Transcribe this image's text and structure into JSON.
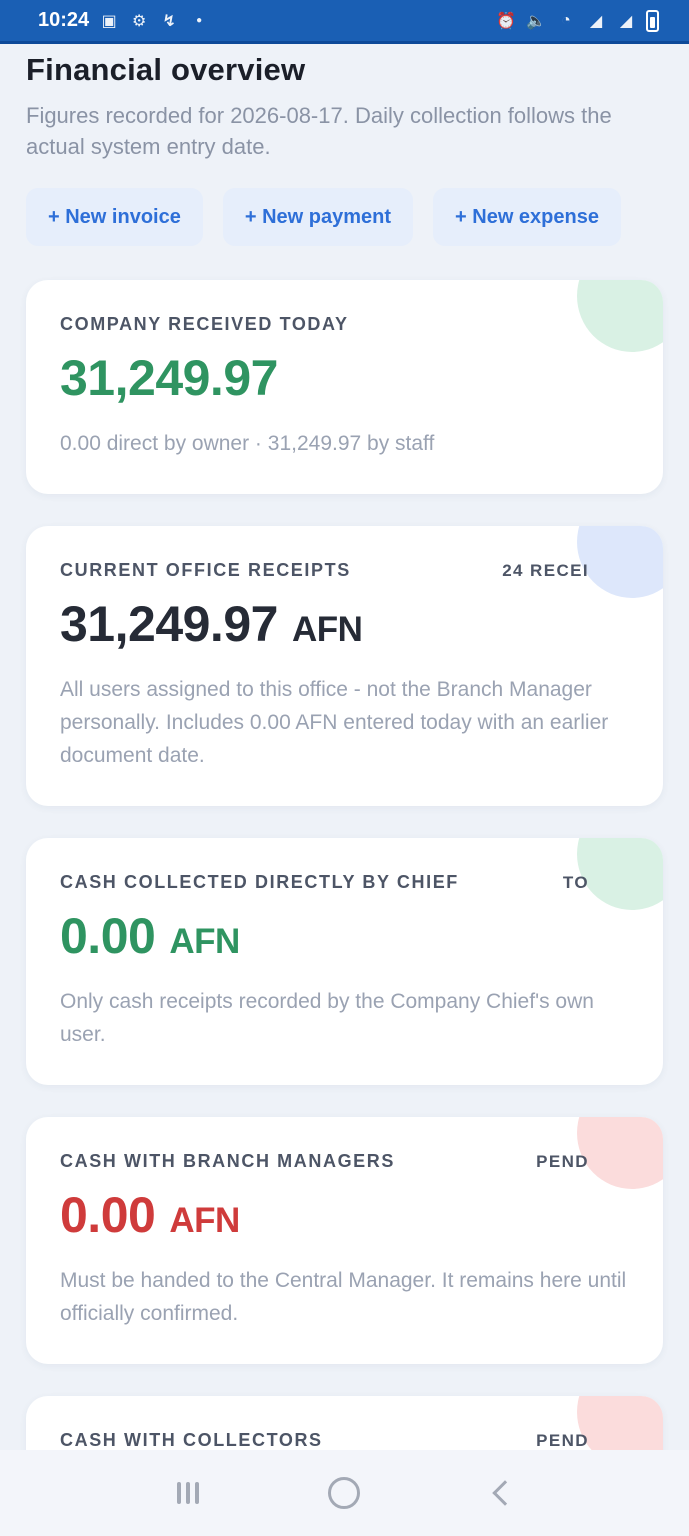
{
  "status_bar": {
    "time": "10:24",
    "left_icons": [
      "image-icon",
      "settings-icon",
      "signal-extra-icon",
      "dot-icon"
    ],
    "right_icons": [
      "alarm-icon",
      "volume-icon",
      "wifi-icon",
      "signal-icon",
      "signal-icon-2",
      "battery-icon"
    ]
  },
  "page": {
    "title": "Financial overview",
    "subtitle": "Figures recorded for 2026-08-17. Daily collection follows the actual system entry date."
  },
  "actions": [
    {
      "label": "+ New invoice"
    },
    {
      "label": "+ New payment"
    },
    {
      "label": "+ New expense"
    }
  ],
  "cards": [
    {
      "label": "Company received today",
      "tag": "",
      "amount": "31,249.97",
      "currency": "",
      "note": "0.00 direct by owner · 31,249.97 by staff",
      "tone": "green"
    },
    {
      "label": "Current office receipts",
      "tag": "24 RECEI",
      "amount": "31,249.97",
      "currency": "AFN",
      "note": "All users assigned to this office - not the Branch Manager personally. Includes 0.00 AFN entered today with an earlier document date.",
      "tone": "dark"
    },
    {
      "label": "Cash collected directly by chief",
      "tag": "TO",
      "amount": "0.00",
      "currency": "AFN",
      "note": "Only cash receipts recorded by the Company Chief's own user.",
      "tone": "green"
    },
    {
      "label": "Cash with branch managers",
      "tag": "PEND",
      "amount": "0.00",
      "currency": "AFN",
      "note": "Must be handed to the Central Manager. It remains here until officially confirmed.",
      "tone": "red"
    },
    {
      "label": "Cash with collectors",
      "tag": "PEND",
      "amount": "",
      "currency": "",
      "note": "",
      "tone": "red"
    }
  ],
  "colors": {
    "status_bar": "#1a5fb4",
    "accent": "#2e6fd8",
    "green": "#2f9461",
    "red": "#cf3b3b"
  }
}
